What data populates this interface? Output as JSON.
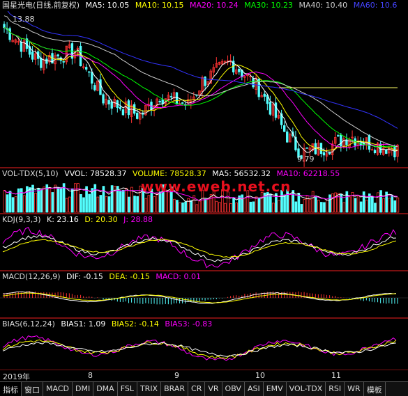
{
  "main_header": {
    "title": "国星光电(日线,前复权)",
    "ma5": "MA5: 10.05",
    "ma10": "MA10: 10.15",
    "ma20": "MA20: 10.24",
    "ma30": "MA30: 10.23",
    "ma40": "MA40: 10.40",
    "ma60": "MA60: 10.6"
  },
  "main_labels": {
    "high": "13.88",
    "low": "9.79"
  },
  "volume_header": {
    "name": "VOL-TDX(5,10)",
    "vvol": "VVOL: 78528.37",
    "volume": "VOLUME: 78528.37",
    "ma5": "MA5: 56532.32",
    "ma10": "MA10: 62218.55"
  },
  "kdj_header": {
    "name": "KDJ(9,3,3)",
    "k": "K: 23.16",
    "d": "D: 20.30",
    "j": "J: 28.88"
  },
  "macd_header": {
    "name": "MACD(12,26,9)",
    "dif": "DIF: -0.15",
    "dea": "DEA: -0.15",
    "macd": "MACD: 0.01"
  },
  "bias_header": {
    "name": "BIAS(6,12,24)",
    "b1": "BIAS1: 1.09",
    "b2": "BIAS2: -0.14",
    "b3": "BIAS3: -0.83"
  },
  "watermark": "www.eweb.net.cn",
  "time_axis": {
    "year": "2019年",
    "m8": "8",
    "m9": "9",
    "m10": "10",
    "m11": "11"
  },
  "tabs": [
    "指标",
    "窗口",
    "MACD",
    "DMI",
    "DMA",
    "FSL",
    "TRIX",
    "BRAR",
    "CR",
    "VR",
    "OBV",
    "ASI",
    "EMV",
    "VOL-TDX",
    "RSI",
    "WR",
    "模板"
  ],
  "colors": {
    "up": "#ff3232",
    "down": "#54ffff",
    "ma5": "#ffffff",
    "ma10": "#ffff00",
    "ma20": "#ff00ff",
    "ma30": "#00ff00",
    "ma40": "#cccccc",
    "ma60": "#3333ff",
    "frame": "#7a1010"
  }
}
